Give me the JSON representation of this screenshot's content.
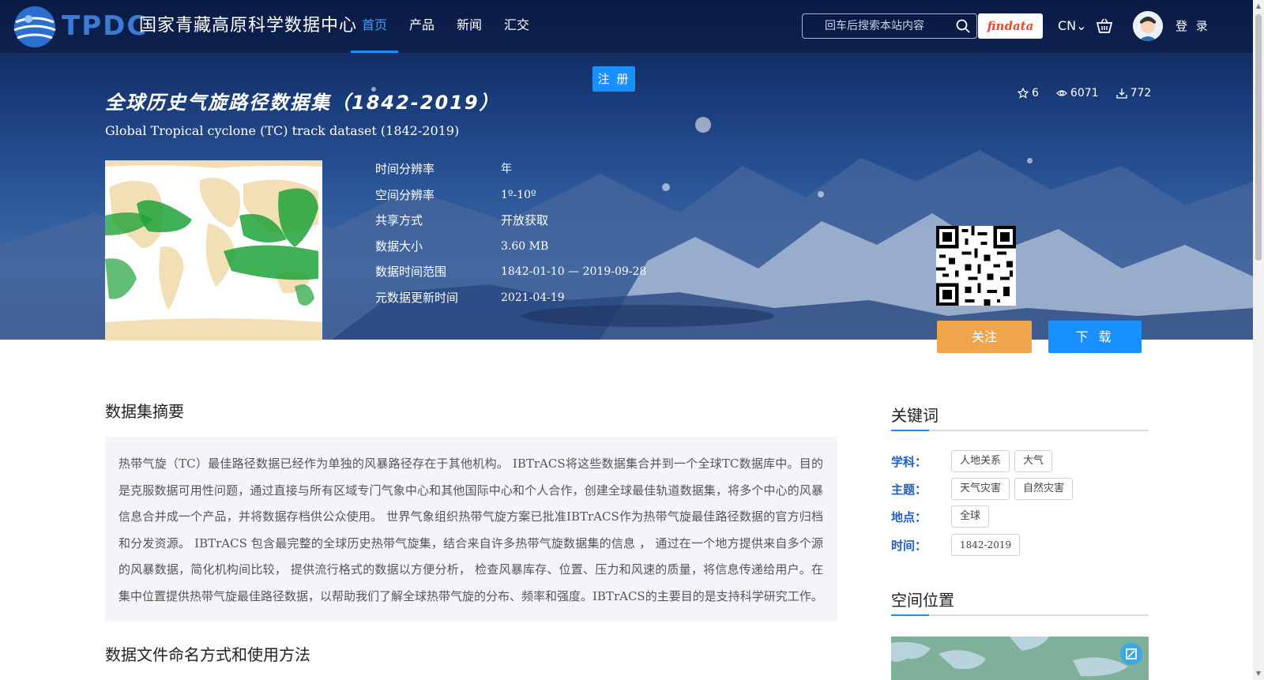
{
  "header": {
    "logo_tpdc": "TPDC",
    "logo_cn": "国家青藏高原科学数据中心",
    "nav": [
      {
        "label": "首页",
        "active": true
      },
      {
        "label": "产品",
        "active": false
      },
      {
        "label": "新闻",
        "active": false
      },
      {
        "label": "汇交",
        "active": false
      }
    ],
    "search_placeholder": "回车后搜索本站内容",
    "findata": "findata",
    "lang": "CN",
    "login": "登 录"
  },
  "register": "注 册",
  "dataset": {
    "title_cn": "全球历史气旋路径数据集（1842-2019）",
    "title_en": "Global Tropical cyclone (TC) track dataset (1842-2019)",
    "stars": "6",
    "views": "6071",
    "downloads": "772",
    "meta": [
      {
        "label": "时间分辨率",
        "value": "年"
      },
      {
        "label": "空间分辨率",
        "value": "1º-10º"
      },
      {
        "label": "共享方式",
        "value": "开放获取"
      },
      {
        "label": "数据大小",
        "value": "3.60 MB"
      },
      {
        "label": "数据时间范围",
        "value": "1842-01-10 — 2019-09-28"
      },
      {
        "label": "元数据更新时间",
        "value": "2021-04-19"
      }
    ],
    "follow": "关注",
    "download": "下 载"
  },
  "abstract": {
    "title": "数据集摘要",
    "text": "热带气旋（TC）最佳路径数据已经作为单独的风暴路径存在于其他机构。 IBTrACS将这些数据集合并到一个全球TC数据库中。目的是克服数据可用性问题，通过直接与所有区域专门气象中心和其他国际中心和个人合作，创建全球最佳轨道数据集，将多个中心的风暴信息合并成一个产品，并将数据存档供公众使用。 世界气象组织热带气旋方案已批准IBTrACS作为热带气旋最佳路径数据的官方归档和分发资源。 IBTrACS 包含最完整的全球历史热带气旋集，结合来自许多热带气旋数据集的信息 ， 通过在一个地方提供来自多个源的风暴数据，简化机构间比较， 提供流行格式的数据以方便分析， 检查风暴库存、位置、压力和风速的质量，将信息传递给用户。在集中位置提供热带气旋最佳路径数据，以帮助我们了解全球热带气旋的分布、频率和强度。IBTrACS的主要目的是支持科学研究工作。"
  },
  "naming": {
    "title": "数据文件命名方式和使用方法"
  },
  "keywords": {
    "title": "关键词",
    "rows": [
      {
        "label": "学科：",
        "tags": [
          "人地关系",
          "大气"
        ]
      },
      {
        "label": "主题：",
        "tags": [
          "天气灾害",
          "自然灾害"
        ]
      },
      {
        "label": "地点：",
        "tags": [
          "全球"
        ]
      },
      {
        "label": "时间：",
        "tags": [
          "1842-2019"
        ]
      }
    ]
  },
  "location": {
    "title": "空间位置"
  },
  "colors": {
    "accent": "#1890ff",
    "follow": "#f0a54a",
    "keyword_label": "#1f5fc4"
  }
}
